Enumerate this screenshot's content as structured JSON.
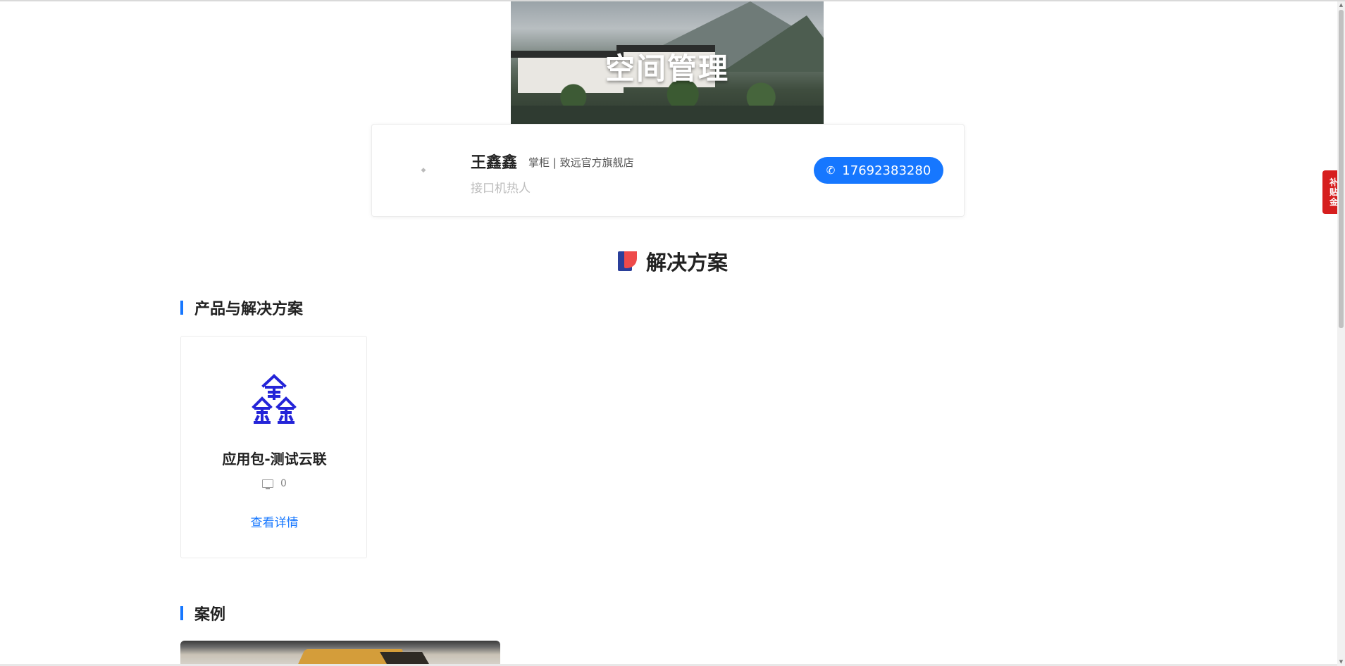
{
  "banner": {
    "title": "空间管理"
  },
  "profile": {
    "name": "王鑫鑫",
    "role": "掌柜 | 致远官方旗舰店",
    "tagline": "接口机热人",
    "phone": "17692383280",
    "phone_icon": "phone-icon",
    "accent_color": "#1677ff"
  },
  "solutions": {
    "section_title": "解决方案",
    "section_icon": "solution-logo-icon",
    "products_heading": "产品与解决方案",
    "products": [
      {
        "name": "应用包-测试云联",
        "count": "0",
        "count_icon": "monitor-icon",
        "link_label": "查看详情"
      }
    ],
    "cases_heading": "案例"
  },
  "sidebar_float": {
    "label_lines": [
      "补",
      "贴",
      "金"
    ],
    "color": "#d61e1e"
  }
}
